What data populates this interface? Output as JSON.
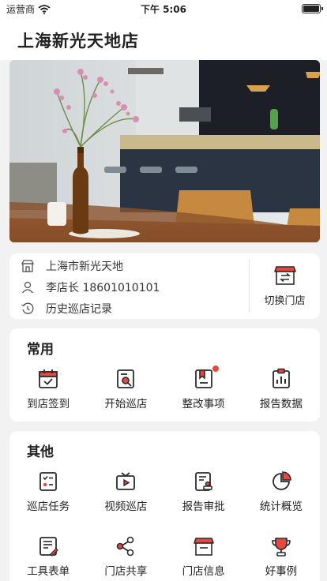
{
  "status": {
    "carrier": "运营商",
    "time": "下午 5:06",
    "battery_level": 1.0
  },
  "header": {
    "title": "上海新光天地店"
  },
  "store_info": {
    "address": "上海市新光天地",
    "manager": "李店长 18601010101",
    "history": "历史巡店记录",
    "switch_label": "切换门店"
  },
  "common": {
    "title": "常用",
    "items": [
      {
        "label": "到店签到",
        "icon": "calendar-check-icon"
      },
      {
        "label": "开始巡店",
        "icon": "search-document-icon"
      },
      {
        "label": "整改事项",
        "icon": "bookmark-list-icon",
        "badge": true
      },
      {
        "label": "报告数据",
        "icon": "bar-chart-report-icon"
      }
    ]
  },
  "other": {
    "title": "其他",
    "items": [
      {
        "label": "巡店任务",
        "icon": "checklist-icon"
      },
      {
        "label": "视频巡店",
        "icon": "tv-play-icon"
      },
      {
        "label": "报告审批",
        "icon": "document-stamp-icon"
      },
      {
        "label": "统计概览",
        "icon": "pie-chart-icon"
      },
      {
        "label": "工具表单",
        "icon": "form-edit-icon"
      },
      {
        "label": "门店共享",
        "icon": "share-icon"
      },
      {
        "label": "门店信息",
        "icon": "store-info-icon"
      },
      {
        "label": "好事例",
        "icon": "trophy-icon"
      }
    ]
  },
  "colors": {
    "accent": "#e8473f",
    "stroke": "#2b2b2b"
  }
}
